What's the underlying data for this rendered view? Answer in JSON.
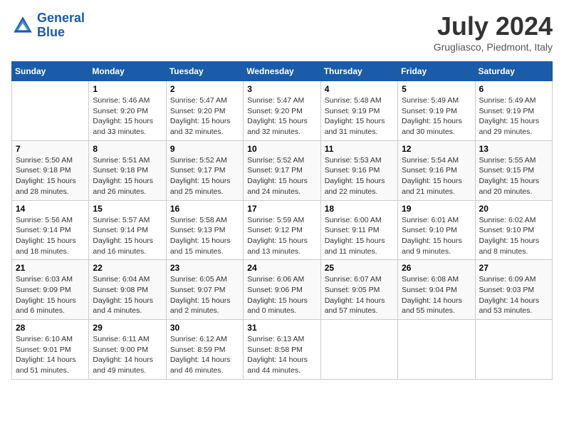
{
  "header": {
    "logo_line1": "General",
    "logo_line2": "Blue",
    "month": "July 2024",
    "location": "Grugliasco, Piedmont, Italy"
  },
  "weekdays": [
    "Sunday",
    "Monday",
    "Tuesday",
    "Wednesday",
    "Thursday",
    "Friday",
    "Saturday"
  ],
  "weeks": [
    [
      {
        "day": "",
        "info": ""
      },
      {
        "day": "1",
        "info": "Sunrise: 5:46 AM\nSunset: 9:20 PM\nDaylight: 15 hours\nand 33 minutes."
      },
      {
        "day": "2",
        "info": "Sunrise: 5:47 AM\nSunset: 9:20 PM\nDaylight: 15 hours\nand 32 minutes."
      },
      {
        "day": "3",
        "info": "Sunrise: 5:47 AM\nSunset: 9:20 PM\nDaylight: 15 hours\nand 32 minutes."
      },
      {
        "day": "4",
        "info": "Sunrise: 5:48 AM\nSunset: 9:19 PM\nDaylight: 15 hours\nand 31 minutes."
      },
      {
        "day": "5",
        "info": "Sunrise: 5:49 AM\nSunset: 9:19 PM\nDaylight: 15 hours\nand 30 minutes."
      },
      {
        "day": "6",
        "info": "Sunrise: 5:49 AM\nSunset: 9:19 PM\nDaylight: 15 hours\nand 29 minutes."
      }
    ],
    [
      {
        "day": "7",
        "info": "Sunrise: 5:50 AM\nSunset: 9:18 PM\nDaylight: 15 hours\nand 28 minutes."
      },
      {
        "day": "8",
        "info": "Sunrise: 5:51 AM\nSunset: 9:18 PM\nDaylight: 15 hours\nand 26 minutes."
      },
      {
        "day": "9",
        "info": "Sunrise: 5:52 AM\nSunset: 9:17 PM\nDaylight: 15 hours\nand 25 minutes."
      },
      {
        "day": "10",
        "info": "Sunrise: 5:52 AM\nSunset: 9:17 PM\nDaylight: 15 hours\nand 24 minutes."
      },
      {
        "day": "11",
        "info": "Sunrise: 5:53 AM\nSunset: 9:16 PM\nDaylight: 15 hours\nand 22 minutes."
      },
      {
        "day": "12",
        "info": "Sunrise: 5:54 AM\nSunset: 9:16 PM\nDaylight: 15 hours\nand 21 minutes."
      },
      {
        "day": "13",
        "info": "Sunrise: 5:55 AM\nSunset: 9:15 PM\nDaylight: 15 hours\nand 20 minutes."
      }
    ],
    [
      {
        "day": "14",
        "info": "Sunrise: 5:56 AM\nSunset: 9:14 PM\nDaylight: 15 hours\nand 18 minutes."
      },
      {
        "day": "15",
        "info": "Sunrise: 5:57 AM\nSunset: 9:14 PM\nDaylight: 15 hours\nand 16 minutes."
      },
      {
        "day": "16",
        "info": "Sunrise: 5:58 AM\nSunset: 9:13 PM\nDaylight: 15 hours\nand 15 minutes."
      },
      {
        "day": "17",
        "info": "Sunrise: 5:59 AM\nSunset: 9:12 PM\nDaylight: 15 hours\nand 13 minutes."
      },
      {
        "day": "18",
        "info": "Sunrise: 6:00 AM\nSunset: 9:11 PM\nDaylight: 15 hours\nand 11 minutes."
      },
      {
        "day": "19",
        "info": "Sunrise: 6:01 AM\nSunset: 9:10 PM\nDaylight: 15 hours\nand 9 minutes."
      },
      {
        "day": "20",
        "info": "Sunrise: 6:02 AM\nSunset: 9:10 PM\nDaylight: 15 hours\nand 8 minutes."
      }
    ],
    [
      {
        "day": "21",
        "info": "Sunrise: 6:03 AM\nSunset: 9:09 PM\nDaylight: 15 hours\nand 6 minutes."
      },
      {
        "day": "22",
        "info": "Sunrise: 6:04 AM\nSunset: 9:08 PM\nDaylight: 15 hours\nand 4 minutes."
      },
      {
        "day": "23",
        "info": "Sunrise: 6:05 AM\nSunset: 9:07 PM\nDaylight: 15 hours\nand 2 minutes."
      },
      {
        "day": "24",
        "info": "Sunrise: 6:06 AM\nSunset: 9:06 PM\nDaylight: 15 hours\nand 0 minutes."
      },
      {
        "day": "25",
        "info": "Sunrise: 6:07 AM\nSunset: 9:05 PM\nDaylight: 14 hours\nand 57 minutes."
      },
      {
        "day": "26",
        "info": "Sunrise: 6:08 AM\nSunset: 9:04 PM\nDaylight: 14 hours\nand 55 minutes."
      },
      {
        "day": "27",
        "info": "Sunrise: 6:09 AM\nSunset: 9:03 PM\nDaylight: 14 hours\nand 53 minutes."
      }
    ],
    [
      {
        "day": "28",
        "info": "Sunrise: 6:10 AM\nSunset: 9:01 PM\nDaylight: 14 hours\nand 51 minutes."
      },
      {
        "day": "29",
        "info": "Sunrise: 6:11 AM\nSunset: 9:00 PM\nDaylight: 14 hours\nand 49 minutes."
      },
      {
        "day": "30",
        "info": "Sunrise: 6:12 AM\nSunset: 8:59 PM\nDaylight: 14 hours\nand 46 minutes."
      },
      {
        "day": "31",
        "info": "Sunrise: 6:13 AM\nSunset: 8:58 PM\nDaylight: 14 hours\nand 44 minutes."
      },
      {
        "day": "",
        "info": ""
      },
      {
        "day": "",
        "info": ""
      },
      {
        "day": "",
        "info": ""
      }
    ]
  ]
}
